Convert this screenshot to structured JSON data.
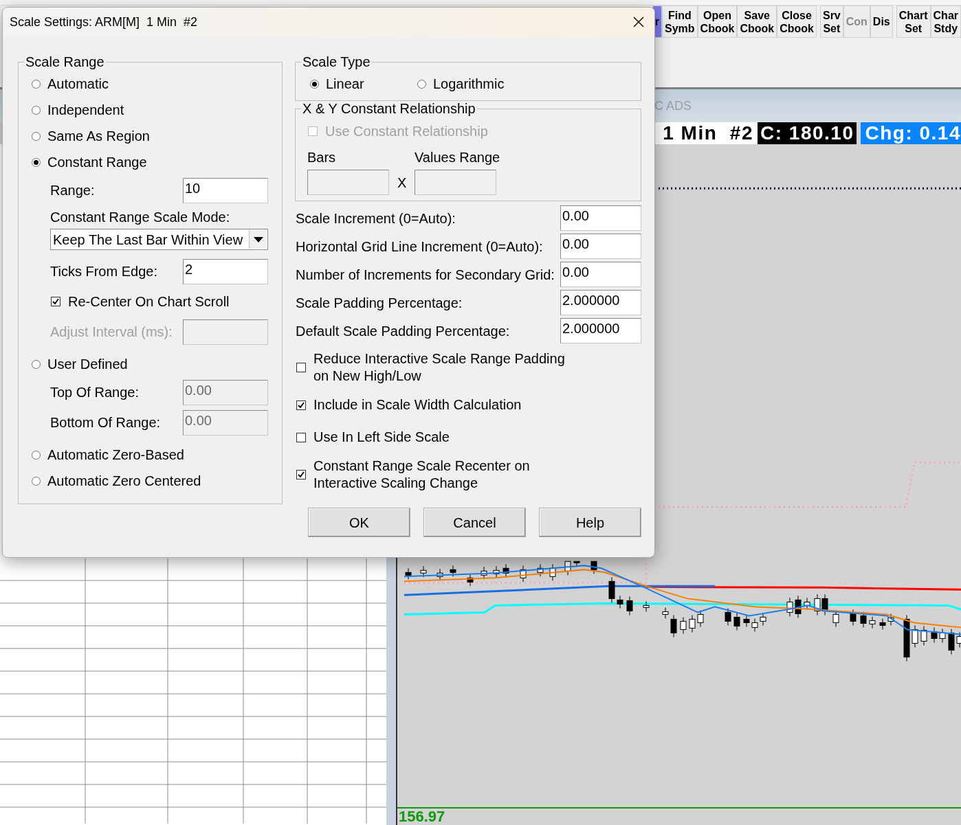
{
  "toolbar": {
    "groups": [
      [
        {
          "lines": [
            "r"
          ],
          "highlighted": true,
          "disabled": false
        },
        {
          "lines": [
            "Find",
            "Symb"
          ],
          "highlighted": false,
          "disabled": false
        },
        {
          "lines": [
            "Open",
            "Cbook"
          ],
          "highlighted": false,
          "disabled": false
        },
        {
          "lines": [
            "Save",
            "Cbook"
          ],
          "highlighted": false,
          "disabled": false
        },
        {
          "lines": [
            "Close",
            "Cbook"
          ],
          "highlighted": false,
          "disabled": false
        }
      ],
      [
        {
          "lines": [
            "Srv",
            "Set"
          ],
          "highlighted": false,
          "disabled": false
        },
        {
          "lines": [
            "Con"
          ],
          "highlighted": false,
          "disabled": true
        },
        {
          "lines": [
            "Dis"
          ],
          "highlighted": false,
          "disabled": false
        }
      ],
      [
        {
          "lines": [
            "Chart",
            "Set"
          ],
          "highlighted": false,
          "disabled": false
        },
        {
          "lines": [
            "Char",
            "Stdy"
          ],
          "highlighted": false,
          "disabled": false
        }
      ]
    ]
  },
  "chart": {
    "panel_title": "C ADS",
    "header": {
      "title": "1 Min  #2",
      "close": "C: 180.10",
      "change": "Chg: 0.14"
    },
    "price_label": "156.97"
  },
  "dialog": {
    "title": "Scale Settings: ARM[M]  1 Min  #2",
    "scale_range": {
      "title": "Scale Range",
      "items": [
        {
          "kind": "radio",
          "label": "Automatic",
          "selected": false
        },
        {
          "kind": "radio",
          "label": "Independent",
          "selected": false
        },
        {
          "kind": "radio",
          "label": "Same As Region",
          "selected": false
        },
        {
          "kind": "radio",
          "label": "Constant Range",
          "selected": true
        },
        {
          "kind": "field",
          "label": "Range:",
          "value": "10",
          "disabled": false
        },
        {
          "kind": "label",
          "label": "Constant Range Scale Mode:"
        },
        {
          "kind": "dropdown",
          "value": "Keep The Last Bar Within View"
        },
        {
          "kind": "field",
          "label": "Ticks From Edge:",
          "value": "2",
          "disabled": false
        },
        {
          "kind": "checkbox",
          "label": "Re-Center On Chart Scroll",
          "checked": true
        },
        {
          "kind": "field",
          "label": "Adjust Interval (ms):",
          "disabled": true
        },
        {
          "kind": "radio",
          "label": "User Defined",
          "selected": false
        },
        {
          "kind": "field",
          "label": "Top Of Range:",
          "value": "0.00",
          "disabled": true
        },
        {
          "kind": "field",
          "label": "Bottom Of Range:",
          "value": "0.00",
          "disabled": true
        },
        {
          "kind": "radio",
          "label": "Automatic Zero-Based",
          "selected": false
        },
        {
          "kind": "radio",
          "label": "Automatic Zero Centered",
          "selected": false
        }
      ]
    },
    "scale_type": {
      "title": "Scale Type",
      "options": [
        {
          "label": "Linear",
          "selected": true
        },
        {
          "label": "Logarithmic",
          "selected": false
        }
      ]
    },
    "xy_relationship": {
      "title": "X & Y Constant Relationship",
      "checkbox": {
        "label": "Use Constant Relationship",
        "checked": false,
        "disabled": true
      },
      "bars_label": "Bars",
      "values_label": "Values Range",
      "separator": "X",
      "fields_disabled": true
    },
    "fields": [
      {
        "label": "Scale Increment (0=Auto):",
        "value": "0.00"
      },
      {
        "label": "Horizontal Grid Line Increment (0=Auto):",
        "value": "0.00"
      },
      {
        "label": "Number of Increments for Secondary Grid:",
        "value": "0.00"
      },
      {
        "label": "Scale Padding Percentage:",
        "value": "2.000000"
      },
      {
        "label": "Default Scale Padding Percentage:",
        "value": "2.000000"
      }
    ],
    "options": [
      {
        "lines": [
          "Reduce Interactive Scale Range Padding",
          "on New High/Low"
        ],
        "checked": false
      },
      {
        "lines": [
          "Include in Scale Width Calculation"
        ],
        "checked": true
      },
      {
        "lines": [
          "Use In Left Side Scale"
        ],
        "checked": false
      },
      {
        "lines": [
          "Constant Range Scale Recenter on",
          "Interactive Scaling Change"
        ],
        "checked": true
      }
    ],
    "buttons": [
      "OK",
      "Cancel",
      "Help"
    ]
  }
}
